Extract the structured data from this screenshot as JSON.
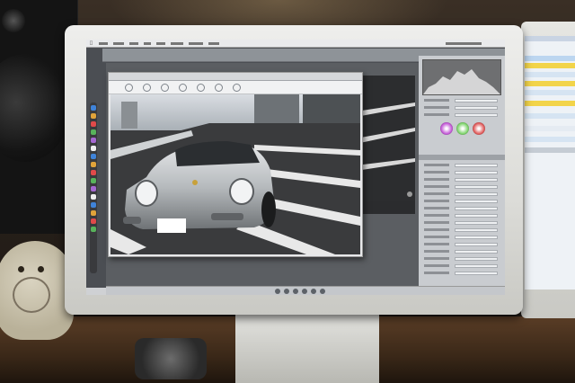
{
  "scene": {
    "description_free": true,
    "colors": {
      "wall": "#2a221c",
      "desk": "#3a2818",
      "bezel": "#dcdcd8",
      "screen_bg": "#4b4e53",
      "panel_bg": "#c9ccd0",
      "car": "#bfc2c4",
      "road": "#3a3b3d"
    }
  },
  "screen": {
    "menu_icons": [
      "apple-icon"
    ],
    "photo_window": {
      "tool_icons": [
        "hand-icon",
        "zoom-icon",
        "crop-icon",
        "rotate-icon",
        "straighten-icon",
        "red-eye-icon",
        "color-picker-icon"
      ]
    },
    "panel": {
      "wheel_colors": [
        "#c35ad6",
        "#7dd36b",
        "#e05a5a"
      ]
    },
    "dock_icon_colors": [
      "#3f83d9",
      "#e0a33a",
      "#e04a4a",
      "#58b35b",
      "#a567d1",
      "#eeeeee",
      "#3f83d9",
      "#e0a33a",
      "#e04a4a",
      "#58b35b",
      "#a567d1",
      "#eeeeee",
      "#3f83d9",
      "#e0a33a",
      "#e04a4a",
      "#58b35b"
    ]
  }
}
